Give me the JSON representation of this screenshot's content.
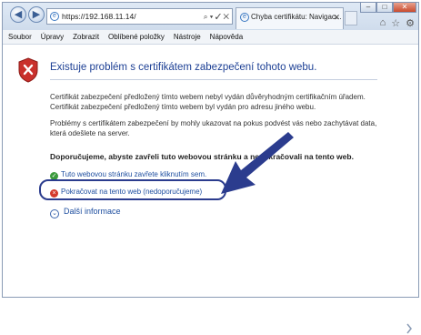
{
  "browser": {
    "url": "https://192.168.11.14/",
    "address_tools": "⌕ ▾ ✓ ✕",
    "tab_title": "Chyba certifikátu: Navigac...",
    "tab_close": "✕",
    "back_icon": "back-arrow-icon",
    "forward_icon": "forward-arrow-icon",
    "window_buttons": [
      "–",
      "□",
      "✕"
    ],
    "toolbar_icons": [
      "home-icon",
      "favorites-star-icon",
      "settings-gear-icon"
    ]
  },
  "menubar": {
    "items": [
      "Soubor",
      "Úpravy",
      "Zobrazit",
      "Oblíbené položky",
      "Nástroje",
      "Nápověda"
    ]
  },
  "page": {
    "headline": "Existuje problém s certifikátem zabezpečení tohoto webu.",
    "paragraph1": "Certifikát zabezpečení předložený tímto webem nebyl vydán důvěryhodným certifikačním úřadem. Certifikát zabezpečení předložený tímto webem byl vydán pro adresu jiného webu.",
    "paragraph2": "Problémy s certifikátem zabezpečení by mohly ukazovat na pokus podvést vás nebo zachytávat data, která odešlete na server.",
    "recommendation": "Doporučujeme, abyste zavřeli tuto webovou stránku a nepokračovali na tento web.",
    "close_link": "Tuto webovou stránku zavřete kliknutím sem.",
    "continue_link": "Pokračovat na tento web (nedoporučujeme)",
    "more_info": "Další informace"
  },
  "colors": {
    "headline": "#1c3f94",
    "link": "#1f4fa0",
    "highlight_border": "#2b3c8e",
    "arrow": "#2b3c8e"
  }
}
